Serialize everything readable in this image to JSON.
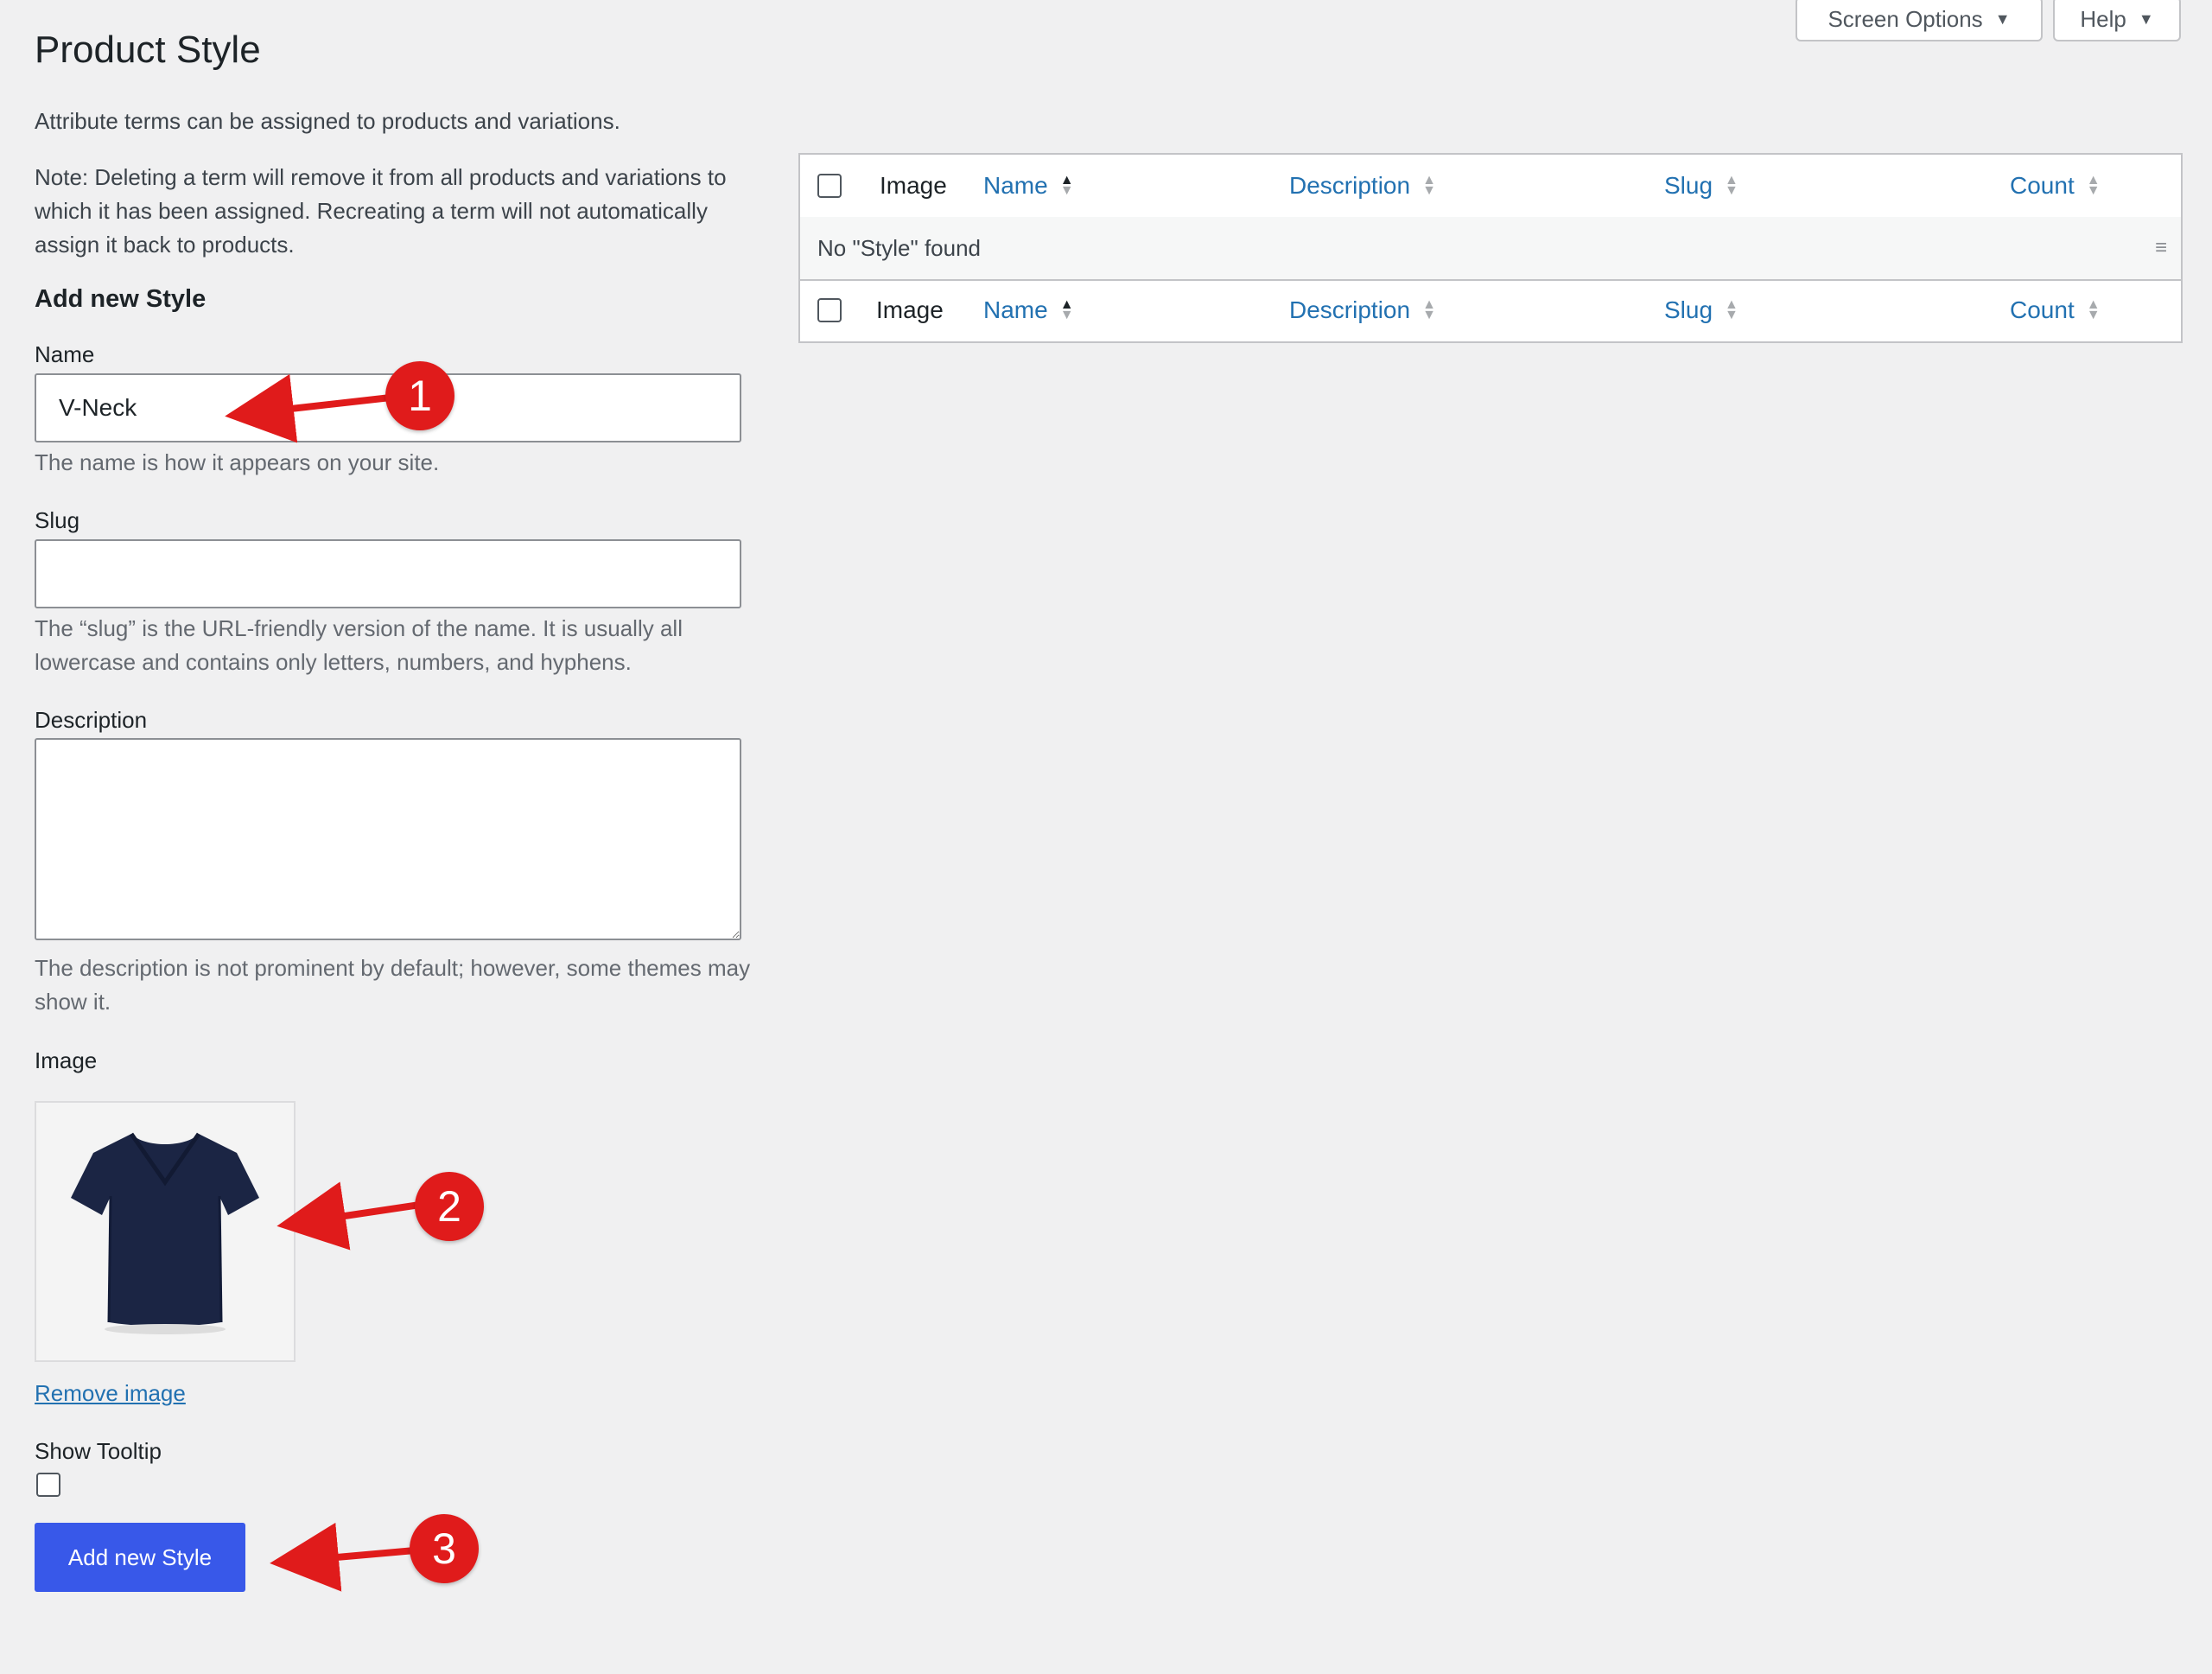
{
  "page": {
    "title": "Product Style",
    "screen_options_label": "Screen Options",
    "help_label": "Help",
    "intro": "Attribute terms can be assigned to products and variations.",
    "note": "Note: Deleting a term will remove it from all products and variations to which it has been assigned. Recreating a term will not automatically assign it back to products."
  },
  "form": {
    "heading": "Add new Style",
    "name_label": "Name",
    "name_value": "V-Neck",
    "name_help": "The name is how it appears on your site.",
    "slug_label": "Slug",
    "slug_value": "",
    "slug_help": "The “slug” is the URL-friendly version of the name. It is usually all lowercase and contains only letters, numbers, and hyphens.",
    "description_label": "Description",
    "description_value": "",
    "description_help": "The description is not prominent by default; however, some themes may show it.",
    "image_label": "Image",
    "remove_image_label": "Remove image",
    "tooltip_label": "Show Tooltip",
    "submit_label": "Add new Style"
  },
  "table": {
    "columns": [
      "Image",
      "Name",
      "Description",
      "Slug",
      "Count"
    ],
    "empty_message": "No \"Style\" found"
  },
  "annotations": [
    "1",
    "2",
    "3"
  ],
  "colors": {
    "accent": "#3858e9",
    "link": "#2271b1",
    "annotation": "#e01b1b",
    "shirt": "#1b2544"
  },
  "icons": {
    "caret": "caret-down-icon",
    "sort": "sort-arrows-icon",
    "row_menu": "row-actions-icon"
  }
}
